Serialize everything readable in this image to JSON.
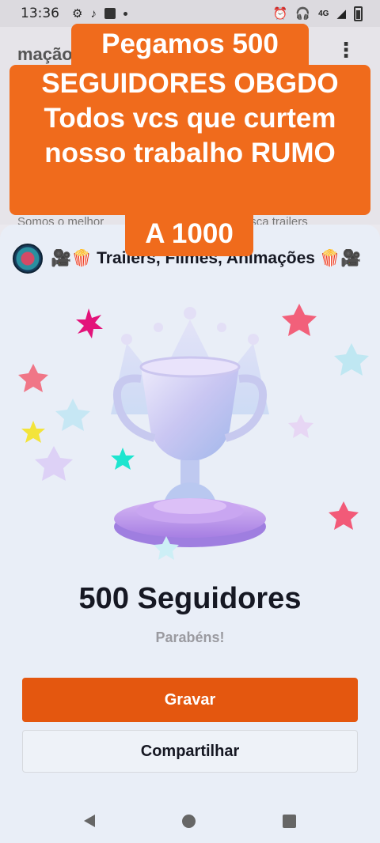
{
  "status_bar": {
    "time": "13:36",
    "network": "4G"
  },
  "background_profile": {
    "title_fragment": "mação",
    "bio_fragment": "Somos o melhor",
    "bio_fragment_right": "busca trailers"
  },
  "sheet": {
    "account_name": "🎥🍿 Trailers, Filmes, Animações 🍿🎥",
    "milestone_title": "500 Seguidores",
    "subtitle": "Parabéns!",
    "primary_button": "Gravar",
    "secondary_button": "Compartilhar"
  },
  "caption": {
    "line1": "Pegamos 500",
    "line2": "SEGUIDORES OBGDO",
    "line3": "Todos vcs que curtem",
    "line4": "nosso trabalho RUMO",
    "line5": "A 1000"
  },
  "colors": {
    "accent": "#e4570f",
    "caption_bg": "#f06b1c",
    "sheet_bg": "#e9eef7"
  }
}
